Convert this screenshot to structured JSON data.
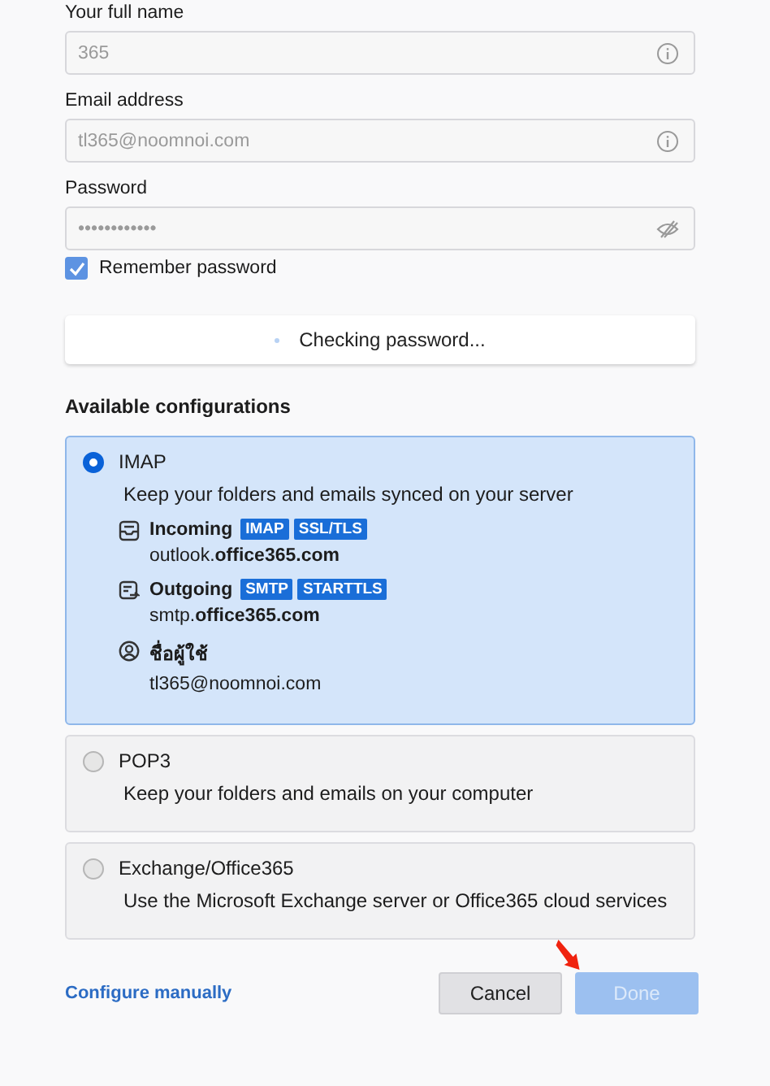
{
  "fields": [
    {
      "label": "Your full name",
      "value": "365",
      "kind": "info",
      "disabled": true
    },
    {
      "label": "Email address",
      "value": "tl365@noomnoi.com",
      "kind": "info",
      "disabled": true
    },
    {
      "label": "Password",
      "value": "••••••••••••",
      "kind": "hidden",
      "disabled": true
    }
  ],
  "remember": {
    "label": "Remember password",
    "checked": true
  },
  "check_button": "Checking password...",
  "section_title": "Available configurations",
  "configs": [
    {
      "name": "IMAP",
      "description": "Keep your folders and emails synced on your server",
      "selected": true,
      "details": [
        {
          "kind": "incoming",
          "label": "Incoming",
          "tags": [
            "IMAP",
            "SSL/TLS"
          ],
          "value": "outlook.**office365.com**"
        },
        {
          "kind": "outgoing",
          "label": "Outgoing",
          "tags": [
            "SMTP",
            "STARTTLS"
          ],
          "value": "smtp.**office365.com**"
        },
        {
          "kind": "user",
          "label": "ชื่อผู้ใช้",
          "value": "tl365@noomnoi.com"
        }
      ]
    },
    {
      "name": "POP3",
      "description": "Keep your folders and emails on your computer",
      "selected": false
    },
    {
      "name": "Exchange/Office365",
      "description": "Use the Microsoft Exchange server or Office365 cloud services",
      "selected": false
    }
  ],
  "configure_link": "Configure manually",
  "buttons": [
    {
      "label": "Cancel",
      "disabled": false
    },
    {
      "label": "Done",
      "disabled": true
    }
  ]
}
